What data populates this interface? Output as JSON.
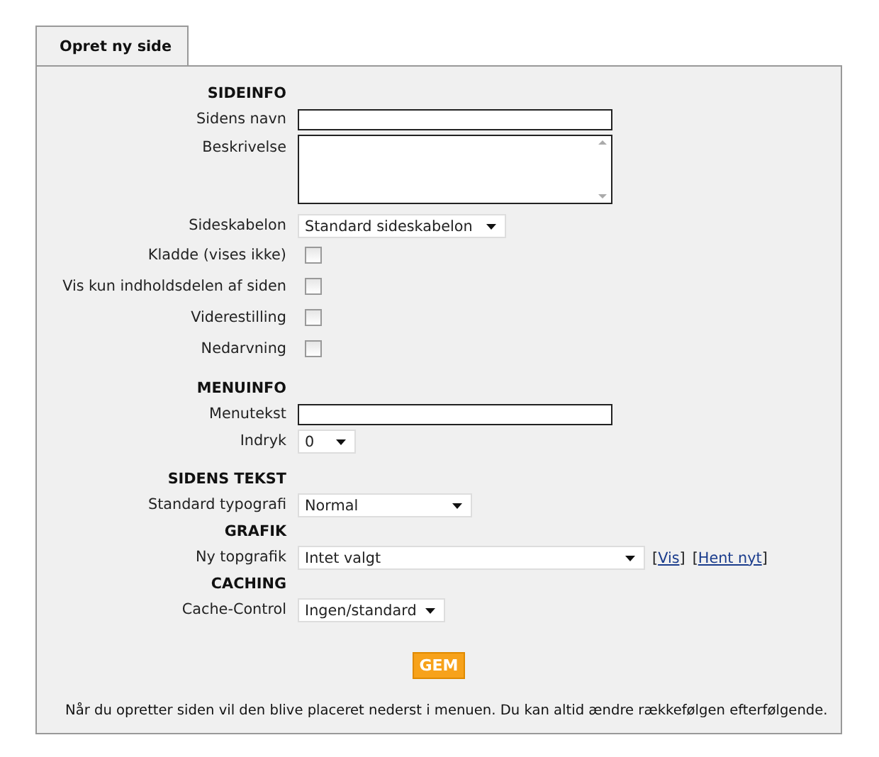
{
  "tab": {
    "label": "Opret ny side",
    "selected": true
  },
  "sections": [
    {
      "heading": "SIDEINFO",
      "fields": [
        {
          "kind": "text",
          "label": "Sidens navn"
        },
        {
          "kind": "textarea",
          "label": "Beskrivelse"
        },
        {
          "kind": "select",
          "label": "Sideskabelon",
          "value": "Standard sideskabelon"
        },
        {
          "kind": "checkbox",
          "label": "Kladde (vises ikke)",
          "checked": false
        },
        {
          "kind": "checkbox",
          "label": "Vis kun indholdsdelen af siden",
          "checked": false
        },
        {
          "kind": "checkbox",
          "label": "Viderestilling",
          "checked": false
        },
        {
          "kind": "checkbox",
          "label": "Nedarvning",
          "checked": false
        }
      ]
    },
    {
      "heading": "MENUINFO",
      "fields": [
        {
          "kind": "text",
          "label": "Menutekst"
        },
        {
          "kind": "select",
          "label": "Indryk",
          "value": "0"
        }
      ]
    },
    {
      "heading": "SIDENS TEKST",
      "fields": [
        {
          "kind": "select",
          "label": "Standard typografi",
          "value": "Normal"
        }
      ]
    },
    {
      "heading": "GRAFIK",
      "fields": [
        {
          "kind": "select",
          "label": "Ny topgrafik",
          "value": "Intet valgt",
          "links": [
            {
              "before": "[",
              "label": "Vis",
              "after": "]"
            },
            {
              "before": "[",
              "label": "Hent nyt",
              "after": "]"
            }
          ]
        }
      ]
    },
    {
      "heading": "CACHING",
      "fields": [
        {
          "kind": "select",
          "label": "Cache-Control",
          "value": "Ingen/standard"
        }
      ]
    }
  ],
  "save_button": "GEM",
  "note": "Når du opretter siden vil den blive placeret nederst i menuen. Du kan altid ændre rækkefølgen efterfølgende."
}
